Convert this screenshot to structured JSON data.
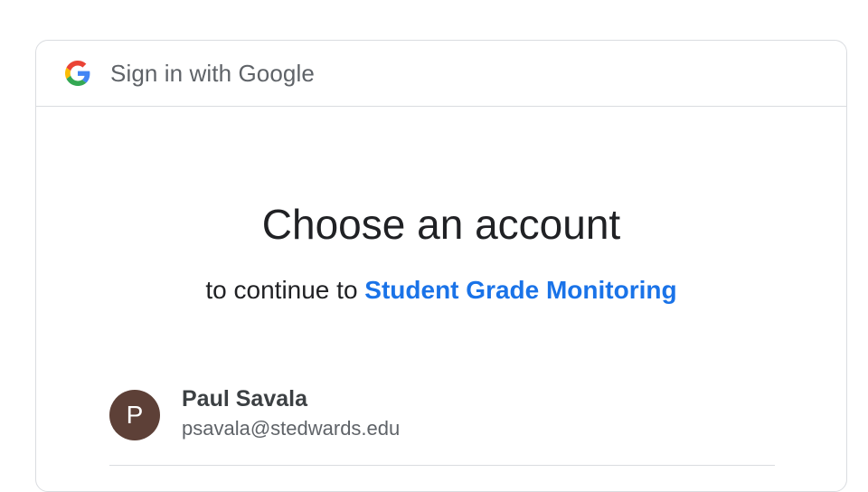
{
  "header": {
    "title": "Sign in with Google",
    "logo_icon": "google-g-icon"
  },
  "main": {
    "title": "Choose an account",
    "subtitle_prefix": "to continue to",
    "app_name": "Student Grade Monitoring"
  },
  "accounts": [
    {
      "avatar_initial": "P",
      "name": "Paul Savala",
      "email": "psavala@stedwards.edu",
      "avatar_color": "#5d4037"
    }
  ],
  "colors": {
    "link": "#1a73e8",
    "text_primary": "#202124",
    "text_secondary": "#5f6368",
    "border": "#dadce0"
  }
}
